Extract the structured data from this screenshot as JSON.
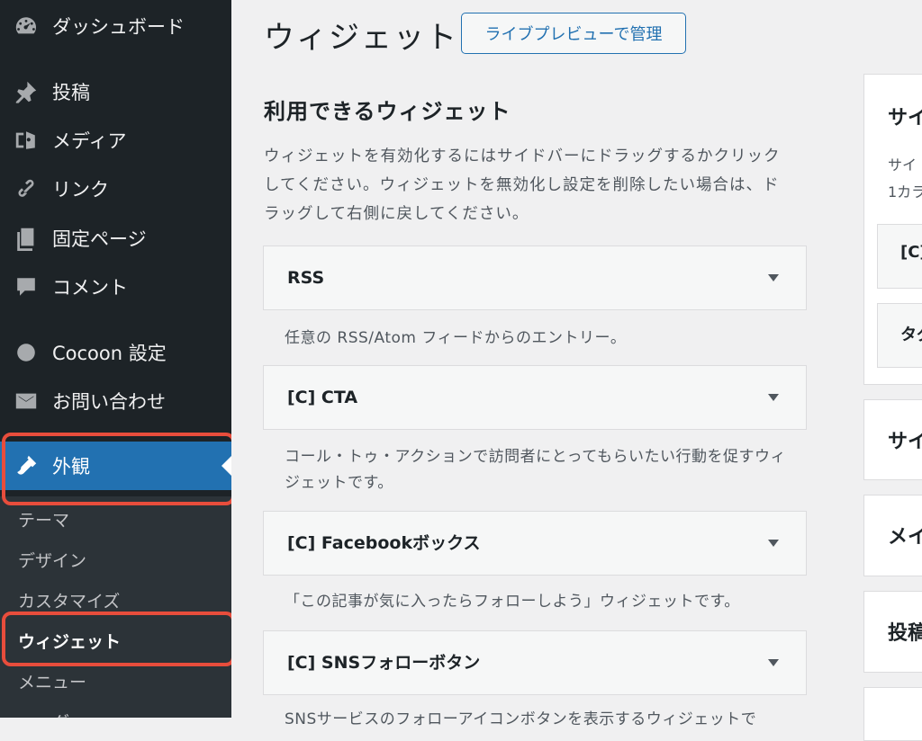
{
  "sidebar": {
    "items": [
      {
        "label": "ダッシュボード",
        "icon": "dashboard-icon"
      },
      {
        "label": "投稿",
        "icon": "pin-icon"
      },
      {
        "label": "メディア",
        "icon": "media-icon"
      },
      {
        "label": "リンク",
        "icon": "link-icon"
      },
      {
        "label": "固定ページ",
        "icon": "pages-icon"
      },
      {
        "label": "コメント",
        "icon": "comment-icon"
      },
      {
        "label": "Cocoon 設定",
        "icon": "circle-icon"
      },
      {
        "label": "お問い合わせ",
        "icon": "mail-icon"
      },
      {
        "label": "外観",
        "icon": "brush-icon"
      }
    ],
    "submenu": [
      "テーマ",
      "デザイン",
      "カスタマイズ",
      "ウィジェット",
      "メニュー",
      "ヘッダー"
    ],
    "highlight_color": "#e84d3c",
    "active_color": "#2271b1"
  },
  "main": {
    "title": "ウィジェット",
    "preview_button": "ライブプレビューで管理",
    "available_heading": "利用できるウィジェット",
    "available_desc": "ウィジェットを有効化するにはサイドバーにドラッグするかクリックしてください。ウィジェットを無効化し設定を削除したい場合は、ドラッグして右側に戻してください。",
    "widgets": [
      {
        "title": "RSS",
        "desc": "任意の RSS/Atom フィードからのエントリー。"
      },
      {
        "title": "[C] CTA",
        "desc": "コール・トゥ・アクションで訪問者にとってもらいたい行動を促すウィジェットです。"
      },
      {
        "title": "[C] Facebookボックス",
        "desc": "「この記事が気に入ったらフォローしよう」ウィジェットです。"
      },
      {
        "title": "[C] SNSフォローボタン",
        "desc": "SNSサービスのフォローアイコンボタンを表示するウィジェットで"
      }
    ]
  },
  "right": {
    "sidebar_title": "サイ",
    "sidebar_desc": [
      "サイ",
      "1カラ"
    ],
    "inner_items": [
      "[C]",
      "タグ"
    ],
    "panels": [
      "サイ",
      "メイ",
      "投稿"
    ]
  }
}
